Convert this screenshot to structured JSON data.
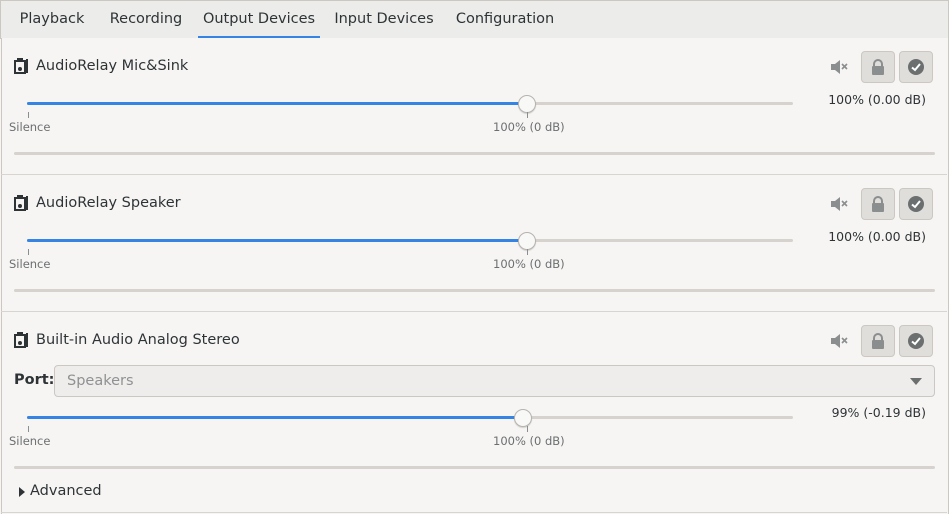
{
  "tabs": [
    {
      "label": "Playback"
    },
    {
      "label": "Recording"
    },
    {
      "label": "Output Devices",
      "active": true
    },
    {
      "label": "Input Devices"
    },
    {
      "label": "Configuration"
    }
  ],
  "devices": [
    {
      "name": "AudioRelay Mic&Sink",
      "volume_text": "100% (0.00 dB)",
      "level": 0.653,
      "silence_label": "Silence",
      "ref_label": "100% (0 dB)"
    },
    {
      "name": "AudioRelay Speaker",
      "volume_text": "100% (0.00 dB)",
      "level": 0.653,
      "silence_label": "Silence",
      "ref_label": "100% (0 dB)"
    },
    {
      "name": "Built-in Audio Analog Stereo",
      "volume_text": "99% (-0.19 dB)",
      "level": 0.648,
      "silence_label": "Silence",
      "ref_label": "100% (0 dB)",
      "port_label": "Port:",
      "port_value": "Speakers"
    }
  ],
  "advanced_label": "Advanced",
  "colors": {
    "accent": "#3584e4"
  },
  "icons": {
    "device": "audio-card-icon",
    "mute": "speaker-muted-icon",
    "lock": "lock-icon",
    "default": "checkmark-icon",
    "expander": "triangle-right-icon"
  }
}
